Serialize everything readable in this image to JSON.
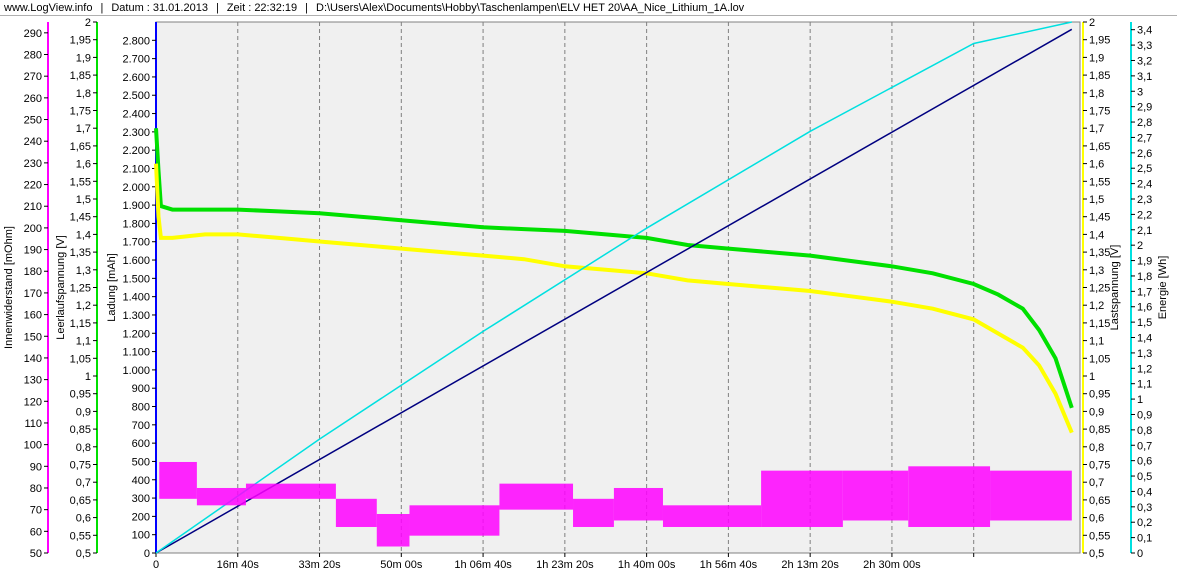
{
  "header": {
    "site": "www.LogView.info",
    "separator": "|",
    "date": "Datum : 31.01.2013",
    "time": "Zeit : 22:32:19",
    "path": "D:\\Users\\Alex\\Documents\\Hobby\\Taschenlampen\\ELV HET 20\\AA_Nice_Lithium_1A.lov"
  },
  "colors": {
    "plot_bg": "#f0f0f0",
    "innenwiderstand": "#ff00ff",
    "leerlaufspannung": "#00e000",
    "ladung": "#000080",
    "lastspannung": "#ffff00",
    "energie": "#00e0e0",
    "axis_ladung": "#0000ff"
  },
  "chart_data": {
    "type": "line",
    "x_axis": {
      "unit": "s",
      "min": 0,
      "max": 11300,
      "ticks": [
        0,
        1000,
        2000,
        3000,
        4000,
        5000,
        6000,
        7000,
        8000,
        9000,
        10000
      ],
      "tick_labels": [
        "0",
        "16m 40s",
        "33m 20s",
        "50m 00s",
        "1h 06m 40s",
        "1h 23m 20s",
        "1h 40m 00s",
        "1h 56m 40s",
        "2h 13m 20s",
        "2h 30m 00s"
      ],
      "grid": true
    },
    "axes": [
      {
        "id": "innenwiderstand",
        "label": "Innenwiderstand [mOhm]",
        "side": "left",
        "min": 50,
        "max": 295,
        "step": 10,
        "tick_labels": [
          "50",
          "60",
          "70",
          "80",
          "90",
          "100",
          "110",
          "120",
          "130",
          "140",
          "150",
          "160",
          "170",
          "180",
          "190",
          "200",
          "210",
          "220",
          "230",
          "240",
          "250",
          "260",
          "270",
          "280",
          "290"
        ]
      },
      {
        "id": "leerlaufspannung",
        "label": "Leerlaufspannung [V]",
        "side": "left",
        "min": 0.5,
        "max": 2.0,
        "step": 0.05,
        "tick_labels": [
          "0,5",
          "0,55",
          "0,6",
          "0,65",
          "0,7",
          "0,75",
          "0,8",
          "0,85",
          "0,9",
          "0,95",
          "1",
          "1,05",
          "1,1",
          "1,15",
          "1,2",
          "1,25",
          "1,3",
          "1,35",
          "1,4",
          "1,45",
          "1,5",
          "1,55",
          "1,6",
          "1,65",
          "1,7",
          "1,75",
          "1,8",
          "1,85",
          "1,9",
          "1,95",
          "2"
        ]
      },
      {
        "id": "ladung",
        "label": "Ladung [mAh]",
        "side": "left",
        "min": 0,
        "max": 2900,
        "step": 100,
        "tick_labels": [
          "0",
          "100",
          "200",
          "300",
          "400",
          "500",
          "600",
          "700",
          "800",
          "900",
          "1.000",
          "1.100",
          "1.200",
          "1.300",
          "1.400",
          "1.500",
          "1.600",
          "1.700",
          "1.800",
          "1.900",
          "2.000",
          "2.100",
          "2.200",
          "2.300",
          "2.400",
          "2.500",
          "2.600",
          "2.700",
          "2.800"
        ]
      },
      {
        "id": "lastspannung",
        "label": "Lastspannung [V]",
        "side": "right",
        "min": 0.5,
        "max": 2.0,
        "step": 0.05,
        "tick_labels": [
          "0,5",
          "0,55",
          "0,6",
          "0,65",
          "0,7",
          "0,75",
          "0,8",
          "0,85",
          "0,9",
          "0,95",
          "1",
          "1,05",
          "1,1",
          "1,15",
          "1,2",
          "1,25",
          "1,3",
          "1,35",
          "1,4",
          "1,45",
          "1,5",
          "1,55",
          "1,6",
          "1,65",
          "1,7",
          "1,75",
          "1,8",
          "1,85",
          "1,9",
          "1,95",
          "2"
        ]
      },
      {
        "id": "energie",
        "label": "Energie [Wh]",
        "side": "right",
        "min": 0,
        "max": 3.45,
        "step": 0.1,
        "tick_labels": [
          "0",
          "0,1",
          "0,2",
          "0,3",
          "0,4",
          "0,5",
          "0,6",
          "0,7",
          "0,8",
          "0,9",
          "1",
          "1,1",
          "1,2",
          "1,3",
          "1,4",
          "1,5",
          "1,6",
          "1,7",
          "1,8",
          "1,9",
          "2",
          "2,1",
          "2,2",
          "2,3",
          "2,4",
          "2,5",
          "2,6",
          "2,7",
          "2,8",
          "2,9",
          "3",
          "3,1",
          "3,2",
          "3,3",
          "3,4"
        ]
      }
    ],
    "series": [
      {
        "id": "leerlaufspannung",
        "axis": "leerlaufspannung",
        "color": "#00e000",
        "x": [
          0,
          30,
          60,
          200,
          600,
          1000,
          1500,
          2000,
          2500,
          3000,
          3500,
          4000,
          4500,
          5000,
          5500,
          6000,
          6500,
          7000,
          7500,
          8000,
          8500,
          9000,
          9500,
          10000,
          10300,
          10600,
          10800,
          11000,
          11200
        ],
        "y": [
          1.7,
          1.58,
          1.48,
          1.47,
          1.47,
          1.47,
          1.465,
          1.46,
          1.45,
          1.44,
          1.43,
          1.42,
          1.415,
          1.41,
          1.4,
          1.39,
          1.37,
          1.36,
          1.35,
          1.34,
          1.325,
          1.31,
          1.29,
          1.26,
          1.23,
          1.19,
          1.13,
          1.05,
          0.91
        ]
      },
      {
        "id": "lastspannung",
        "axis": "lastspannung",
        "color": "#ffff00",
        "x": [
          0,
          30,
          60,
          200,
          600,
          1000,
          1500,
          2000,
          2500,
          3000,
          3500,
          4000,
          4500,
          5000,
          5500,
          6000,
          6500,
          7000,
          7500,
          8000,
          8500,
          9000,
          9500,
          10000,
          10300,
          10600,
          10800,
          11000,
          11200
        ],
        "y": [
          1.6,
          1.45,
          1.39,
          1.39,
          1.4,
          1.4,
          1.39,
          1.38,
          1.37,
          1.36,
          1.35,
          1.34,
          1.33,
          1.31,
          1.3,
          1.29,
          1.27,
          1.26,
          1.25,
          1.24,
          1.225,
          1.21,
          1.19,
          1.16,
          1.12,
          1.08,
          1.03,
          0.95,
          0.84
        ]
      },
      {
        "id": "ladung",
        "axis": "ladung",
        "color": "#000080",
        "x": [
          0,
          11200
        ],
        "y": [
          0,
          2860
        ]
      },
      {
        "id": "energie",
        "axis": "energie",
        "color": "#00e0e0",
        "x": [
          0,
          2000,
          4000,
          6000,
          8000,
          10000,
          11200
        ],
        "y": [
          0,
          0.74,
          1.44,
          2.11,
          2.74,
          3.31,
          3.45
        ]
      },
      {
        "id": "innenwiderstand",
        "axis": "innenwiderstand",
        "color": "#ff00ff",
        "segments": [
          {
            "x0": 40,
            "x1": 500,
            "lo": 75,
            "hi": 92
          },
          {
            "x0": 500,
            "x1": 1100,
            "lo": 72,
            "hi": 80
          },
          {
            "x0": 1100,
            "x1": 2200,
            "lo": 75,
            "hi": 82
          },
          {
            "x0": 2200,
            "x1": 2700,
            "lo": 62,
            "hi": 75
          },
          {
            "x0": 2700,
            "x1": 3100,
            "lo": 53,
            "hi": 68
          },
          {
            "x0": 3100,
            "x1": 4200,
            "lo": 58,
            "hi": 72
          },
          {
            "x0": 4200,
            "x1": 5100,
            "lo": 70,
            "hi": 82
          },
          {
            "x0": 5100,
            "x1": 5600,
            "lo": 62,
            "hi": 75
          },
          {
            "x0": 5600,
            "x1": 6200,
            "lo": 65,
            "hi": 80
          },
          {
            "x0": 6200,
            "x1": 7400,
            "lo": 62,
            "hi": 72
          },
          {
            "x0": 7400,
            "x1": 8400,
            "lo": 62,
            "hi": 88
          },
          {
            "x0": 8400,
            "x1": 9200,
            "lo": 65,
            "hi": 88
          },
          {
            "x0": 9200,
            "x1": 10200,
            "lo": 62,
            "hi": 90
          },
          {
            "x0": 10200,
            "x1": 11200,
            "lo": 65,
            "hi": 88
          }
        ]
      }
    ]
  }
}
